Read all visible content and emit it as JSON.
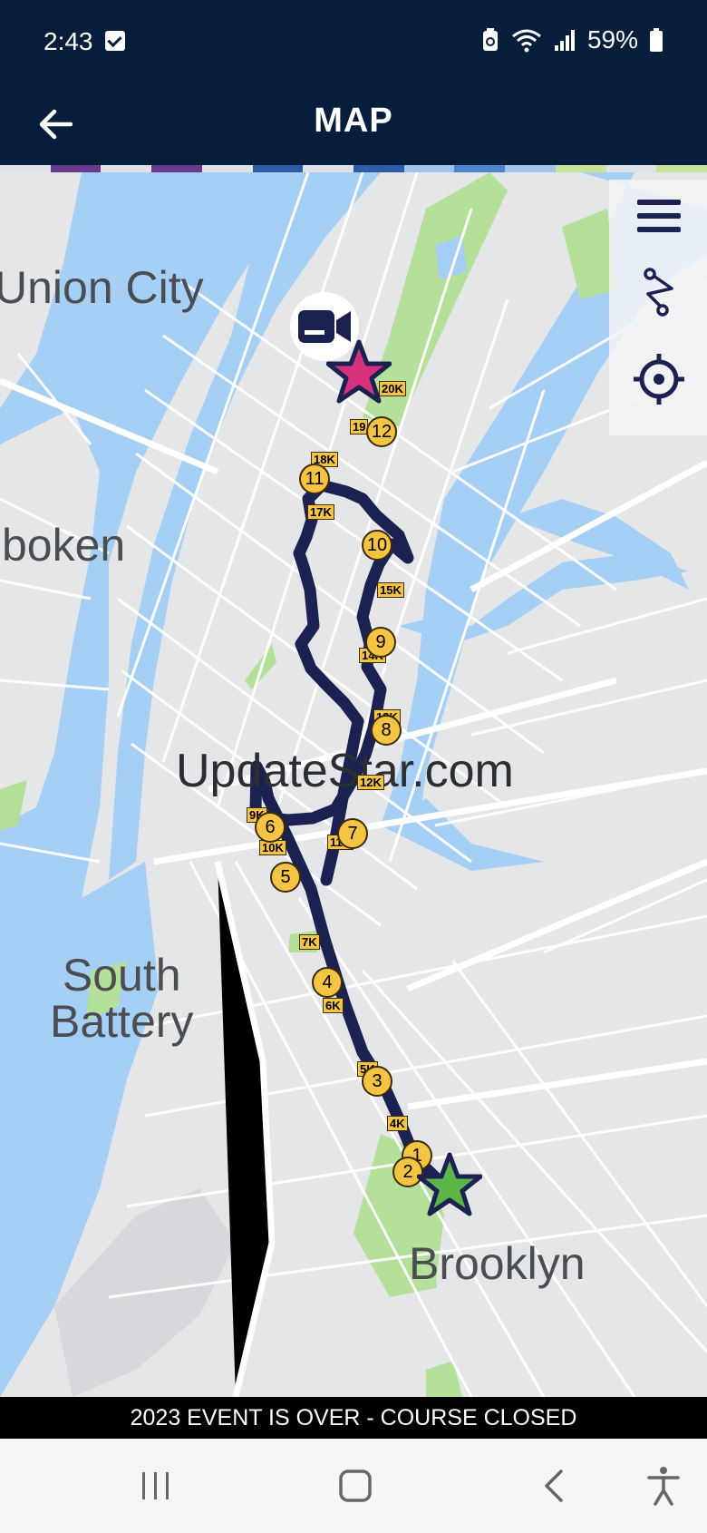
{
  "status_bar": {
    "time": "2:43",
    "battery": "59%"
  },
  "app_bar": {
    "title": "MAP"
  },
  "map": {
    "place_labels": [
      "Union City",
      "boken",
      "South\nBattery",
      "Brooklyn"
    ],
    "watermark": "UpdateStar.com",
    "mile_markers": [
      "1",
      "2",
      "3",
      "4",
      "5",
      "6",
      "7",
      "8",
      "9",
      "10",
      "11",
      "12"
    ],
    "km_markers": [
      "4K",
      "5K",
      "6K",
      "7K",
      "9K",
      "10K",
      "11K",
      "12K",
      "13K",
      "14K",
      "15K",
      "17K",
      "18K",
      "19",
      "20K"
    ]
  },
  "footer": {
    "notice": "2023 EVENT IS OVER - COURSE CLOSED"
  },
  "colors": {
    "header": "#071d3c",
    "route": "#1b2151",
    "marker": "#f5c443",
    "start_star": "#5bb547",
    "finish_star": "#d6317d",
    "water": "#a6cff5",
    "park": "#b5e09a"
  },
  "icons": [
    "back-arrow-icon",
    "menu-icon",
    "route-icon",
    "locate-icon",
    "video-camera-icon",
    "start-star-icon",
    "finish-star-icon",
    "recents-icon",
    "home-icon",
    "nav-back-icon",
    "accessibility-icon"
  ]
}
